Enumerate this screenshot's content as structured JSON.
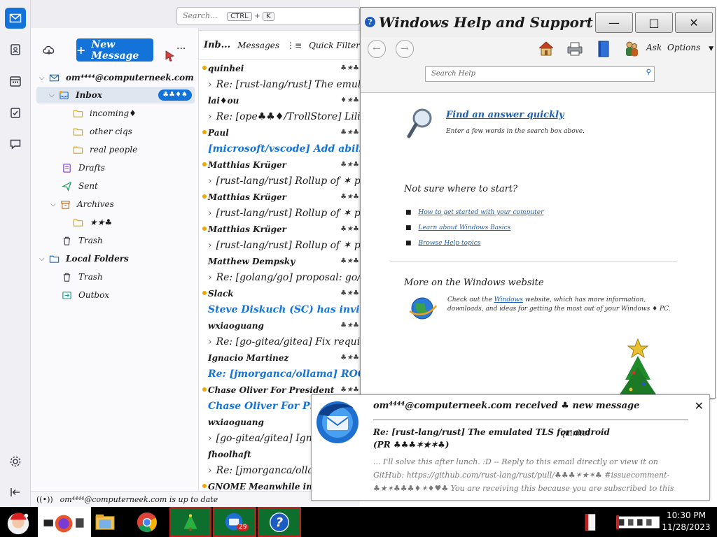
{
  "app": {
    "search_placeholder": "Search...",
    "search_shortcut_key1": "CTRL",
    "search_shortcut_key2": "K",
    "new_message_label": "New Message",
    "more_label": "···"
  },
  "folders": {
    "account": "om⁴⁴⁴⁴@computerneek.com",
    "inbox": "Inbox",
    "inbox_badge": "♣♣♦♠",
    "inbox_children": [
      "incoming♦",
      "other ciqs",
      "real people"
    ],
    "drafts": "Drafts",
    "sent": "Sent",
    "archives": "Archives",
    "archives_child": "★★♣",
    "trash": "Trash",
    "local_folders": "Local Folders",
    "local_trash": "Trash",
    "outbox": "Outbox"
  },
  "msglist_toolbar": {
    "title": "Inb...",
    "messages_label": "Messages",
    "quick_filter_label": "Quick Filter"
  },
  "messages": [
    {
      "sender": "quinhei",
      "meta": "♣★♣",
      "subject": "Re: [rust-lang/rust] The emulated TLS for android",
      "unread": true,
      "blue": false,
      "chevron": true
    },
    {
      "sender": "lai♦ou",
      "meta": "♦★♣",
      "subject": "Re: [ope♣♣♦/TrollStore] Lilid not in",
      "unread": false,
      "blue": false,
      "chevron": true
    },
    {
      "sender": "Paul",
      "meta": "♣★♣",
      "subject": "[microsoft/vscode] Add ability to reveal a",
      "unread": true,
      "blue": true,
      "chevron": false
    },
    {
      "sender": "Matthias Krüger",
      "meta": "♣★♣",
      "subject": "[rust-lang/rust] Rollup of ✶ pull reques",
      "unread": true,
      "blue": false,
      "chevron": true
    },
    {
      "sender": "Matthias Krüger",
      "meta": "♣★♣",
      "subject": "[rust-lang/rust] Rollup of ✶ pull reques",
      "unread": true,
      "blue": false,
      "chevron": true
    },
    {
      "sender": "Matthias Krüger",
      "meta": "♣★♣",
      "subject": "[rust-lang/rust] Rollup of ✶ pull reques",
      "unread": true,
      "blue": false,
      "chevron": true
    },
    {
      "sender": "Matthew Dempsky",
      "meta": "♣★♣",
      "subject": "Re: [golang/go] proposal: go/types: add",
      "unread": false,
      "blue": false,
      "chevron": true
    },
    {
      "sender": "Slack",
      "meta": "♣★♣",
      "subject": "Steve Diskuch (SC) has invited you to w",
      "unread": true,
      "blue": true,
      "chevron": false
    },
    {
      "sender": "wxiaoguang",
      "meta": "♣★♣",
      "subject": "Re: [go-gitea/gitea] Fix required error",
      "unread": false,
      "blue": false,
      "chevron": true
    },
    {
      "sender": "Ignacio Martinez",
      "meta": "♣★♣",
      "subject": "Re: [jmorganca/ollama] ROCm support (",
      "unread": false,
      "blue": true,
      "chevron": false
    },
    {
      "sender": "Chase Oliver For President",
      "meta": "♣★♣",
      "subject": "Chase Oliver For President",
      "unread": true,
      "blue": true,
      "chevron": false
    },
    {
      "sender": "wxiaoguang",
      "meta": "",
      "subject": "[go-gitea/gitea] Ignore \"no",
      "unread": false,
      "blue": false,
      "chevron": true
    },
    {
      "sender": "fhoolhaft",
      "meta": "",
      "subject": "Re: [jmorganca/ollama] ROCm",
      "unread": false,
      "blue": false,
      "chevron": true
    },
    {
      "sender": "GNOME Meanwhile in America",
      "meta": "",
      "subject": "",
      "unread": true,
      "blue": false,
      "chevron": false
    }
  ],
  "statusbar": {
    "text": "om⁴⁴⁴⁴@computerneek.com is up to date"
  },
  "help": {
    "title": "Windows Help and Support",
    "search_placeholder": "Search Help",
    "ask_label": "Ask",
    "options_label": "Options",
    "find_answer_title": "Find an answer quickly",
    "find_answer_desc": "Enter a few words in the search box above.",
    "not_sure_heading": "Not sure where to start?",
    "links": [
      "How to get started with your computer",
      "Learn about Windows Basics",
      "Browse Help topics"
    ],
    "more_heading": "More on the Windows website",
    "more_desc_pre": "Check out the ",
    "more_desc_link": "Windows",
    "more_desc_post": " website, which has more information, downloads, and ideas for getting the most out of your Windows ♦ PC."
  },
  "notification": {
    "title": "om⁴⁴⁴⁴@computerneek.com received ♣ new message",
    "subject": "Re: [rust-lang/rust] The emulated TLS for android",
    "sender": "quinhei",
    "pr_line": "(PR ♣♣♣✶★✶♣)",
    "body": "... I'll solve this after lunch. :D -- Reply to this email directly or view it on GitHub: https://github.com/rust-lang/rust/pull/♣♣♣✶★✶♣ #issuecomment-♣★✶♣♣♣♦✶♦♥♣ You are receiving this because you are subscribed to this thread. Message ID: <rus"
  },
  "taskbar": {
    "time": "10:30 PM",
    "date": "11/28/2023",
    "thunderbird_badge": "29"
  },
  "colors": {
    "accent": "#1373d9",
    "unread_dot": "#e8a800"
  }
}
